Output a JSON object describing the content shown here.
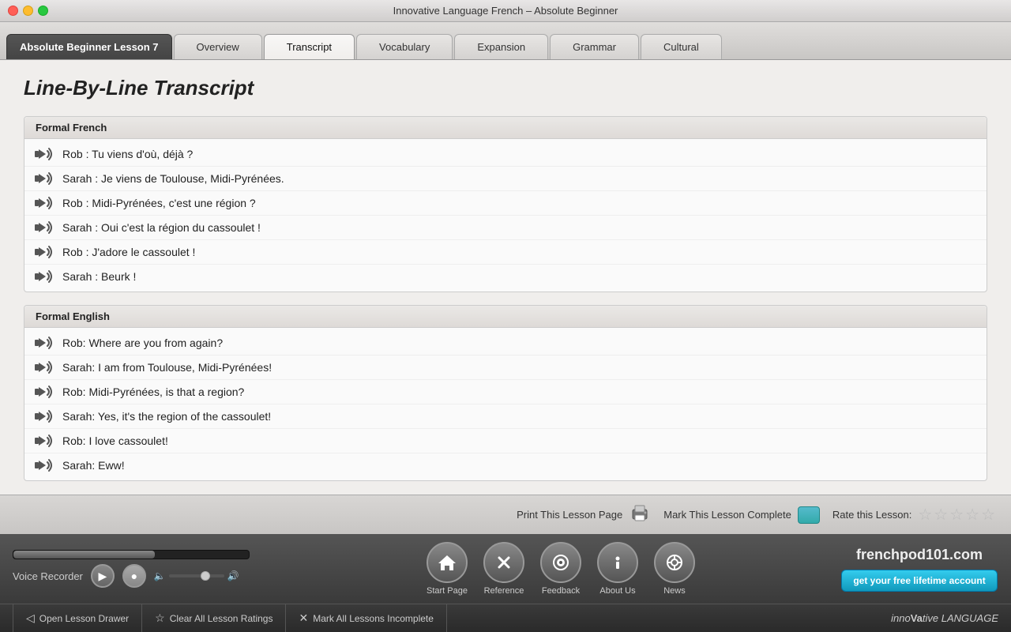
{
  "window": {
    "title": "Innovative Language French – Absolute Beginner"
  },
  "tabs": {
    "lesson": "Absolute Beginner Lesson 7",
    "items": [
      {
        "id": "overview",
        "label": "Overview",
        "active": false
      },
      {
        "id": "transcript",
        "label": "Transcript",
        "active": true
      },
      {
        "id": "vocabulary",
        "label": "Vocabulary",
        "active": false
      },
      {
        "id": "expansion",
        "label": "Expansion",
        "active": false
      },
      {
        "id": "grammar",
        "label": "Grammar",
        "active": false
      },
      {
        "id": "cultural",
        "label": "Cultural",
        "active": false
      }
    ]
  },
  "page_title": "Line-By-Line Transcript",
  "french_section": {
    "header": "Formal French",
    "lines": [
      "Rob : Tu viens d'où, déjà ?",
      "Sarah : Je viens de Toulouse, Midi-Pyrénées.",
      "Rob : Midi-Pyrénées, c'est une région ?",
      "Sarah : Oui c'est la région du cassoulet !",
      "Rob : J'adore le cassoulet !",
      "Sarah : Beurk !"
    ]
  },
  "english_section": {
    "header": "Formal English",
    "lines": [
      "Rob: Where are you from again?",
      "Sarah: I am from Toulouse, Midi-Pyrénées!",
      "Rob: Midi-Pyrénées, is that a region?",
      "Sarah: Yes, it's the region of the cassoulet!",
      "Rob: I love cassoulet!",
      "Sarah: Eww!"
    ]
  },
  "action_bar": {
    "print_label": "Print This Lesson Page",
    "complete_label": "Mark This Lesson Complete",
    "rate_label": "Rate this Lesson:"
  },
  "media_bar": {
    "voice_recorder_label": "Voice Recorder",
    "play_btn": "▶",
    "record_btn": "●"
  },
  "nav_icons": [
    {
      "id": "start-page",
      "icon": "⌂",
      "label": "Start Page"
    },
    {
      "id": "reference",
      "icon": "✕",
      "label": "Reference"
    },
    {
      "id": "feedback",
      "icon": "◉",
      "label": "Feedback"
    },
    {
      "id": "about-us",
      "icon": "ℹ",
      "label": "About Us"
    },
    {
      "id": "news",
      "icon": "⊕",
      "label": "News"
    }
  ],
  "frenchpod": {
    "logo_main": "frenchpod101.com",
    "free_account_btn": "get your free lifetime account"
  },
  "bottom_nav": {
    "items": [
      {
        "id": "open-lesson-drawer",
        "icon": "◁",
        "label": "Open Lesson Drawer"
      },
      {
        "id": "clear-ratings",
        "icon": "☆",
        "label": "Clear All Lesson Ratings"
      },
      {
        "id": "mark-incomplete",
        "icon": "✕",
        "label": "Mark All Lessons Incomplete"
      }
    ],
    "logo": "inno",
    "logo_bold": "Va",
    "logo_rest": "tive LANGUAGE"
  }
}
